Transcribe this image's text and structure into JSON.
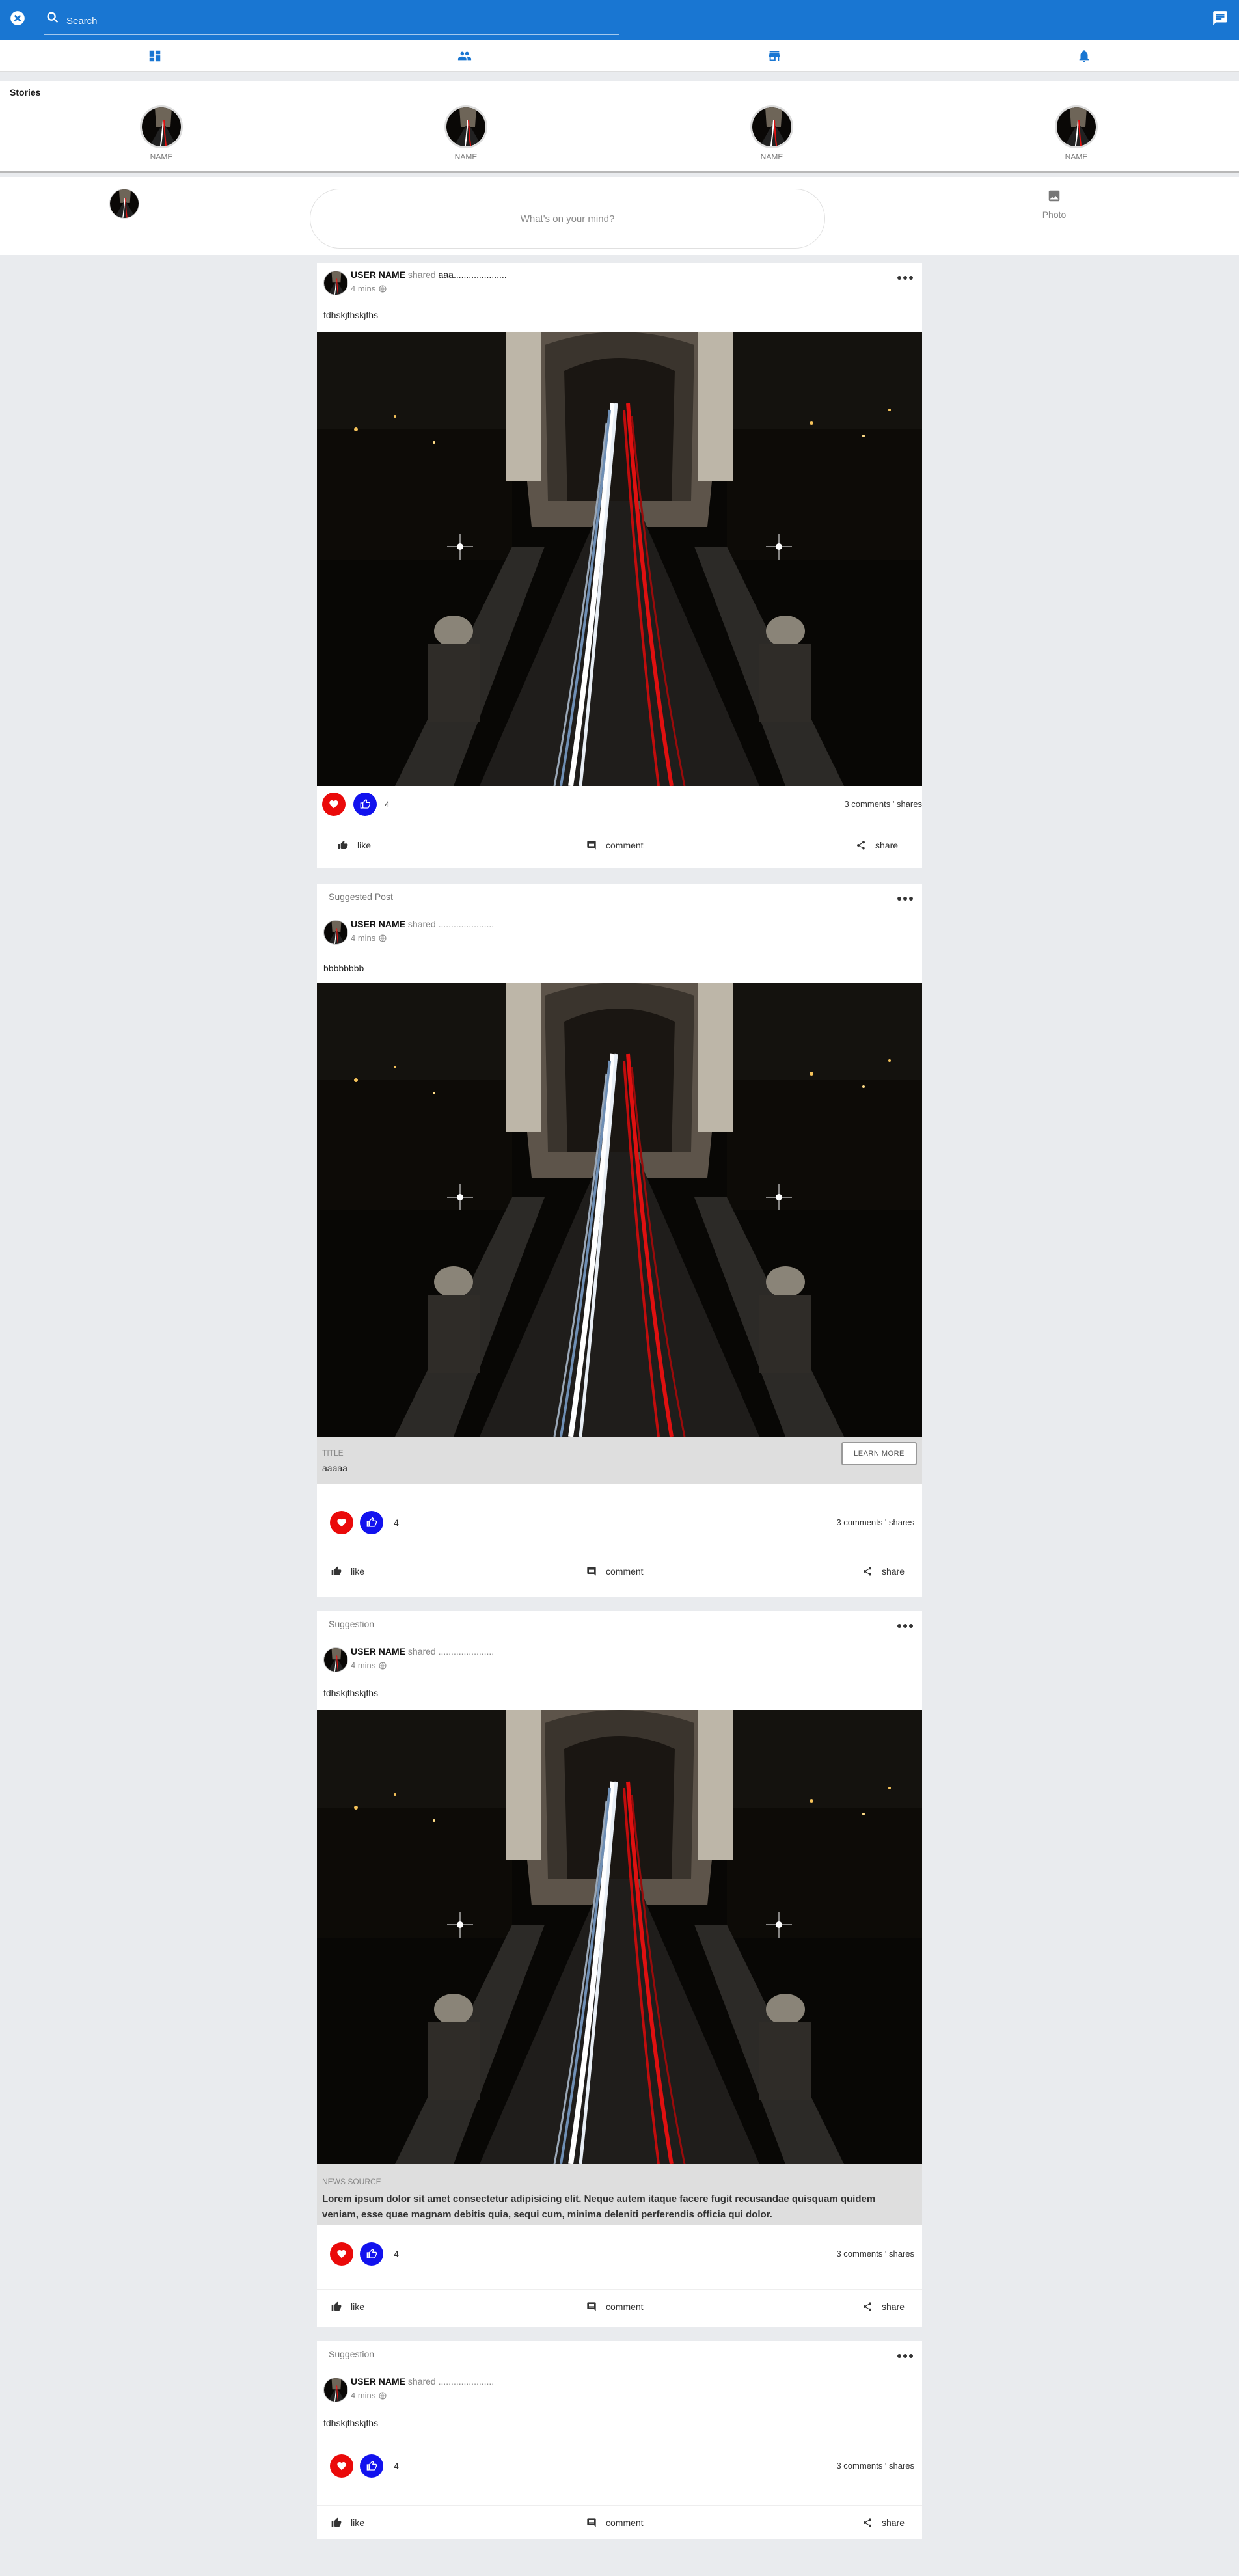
{
  "topbar": {
    "search_placeholder": "Search"
  },
  "stories": {
    "title": "Stories",
    "items": [
      {
        "name": "NAME"
      },
      {
        "name": "NAME"
      },
      {
        "name": "NAME"
      },
      {
        "name": "NAME"
      }
    ]
  },
  "composer": {
    "placeholder": "What's on your mind?",
    "photo_label": "Photo"
  },
  "posts": [
    {
      "label": "",
      "user": "USER NAME",
      "shared": "shared",
      "target": "aaa.....................",
      "time": "4 mins",
      "text": "fdhskjfhskjfhs",
      "reaction_count": "4",
      "stats": "3 comments ' shares",
      "like": "like",
      "comment": "comment",
      "share": "share"
    },
    {
      "label": "Suggested Post",
      "user": "USER NAME",
      "shared": "shared",
      "target": "......................",
      "time": "4 mins",
      "text": "bbbbbbbb",
      "cta_title": "TITLE",
      "cta_subtitle": "aaaaa",
      "cta_button": "LEARN MORE",
      "reaction_count": "4",
      "stats": "3 comments ' shares",
      "like": "like",
      "comment": "comment",
      "share": "share"
    },
    {
      "label": "Suggestion",
      "user": "USER NAME",
      "shared": "shared",
      "target": "......................",
      "time": "4 mins",
      "text": "fdhskjfhskjfhs",
      "news_source": "NEWS SOURCE",
      "news_body": "Lorem ipsum dolor sit amet consectetur adipisicing elit. Neque autem itaque facere fugit recusandae quisquam quidem veniam, esse quae magnam debitis quia, sequi cum, minima deleniti perferendis officia qui dolor.",
      "reaction_count": "4",
      "stats": "3 comments ' shares",
      "like": "like",
      "comment": "comment",
      "share": "share"
    },
    {
      "label": "Suggestion",
      "user": "USER NAME",
      "shared": "shared",
      "target": "......................",
      "time": "4 mins",
      "text": "fdhskjfhskjfhs",
      "reaction_count": "4",
      "stats": "3 comments ' shares",
      "like": "like",
      "comment": "comment",
      "share": "share"
    }
  ],
  "icons": {
    "close": "close-circle-icon",
    "search": "search-icon",
    "chat": "chat-icon",
    "nav": [
      "dashboard-icon",
      "people-icon",
      "store-icon",
      "bell-icon"
    ],
    "photo": "image-icon",
    "globe": "globe-icon",
    "more": "more-horiz-icon",
    "heart": "heart-icon",
    "thumb": "thumbs-up-icon",
    "like": "thumbs-up-icon",
    "comment": "comment-icon",
    "share": "share-icon"
  },
  "colors": {
    "brand": "#1976d2",
    "heart": "#ea0a0a",
    "thumb": "#1212ee",
    "background": "#e9ebee"
  }
}
